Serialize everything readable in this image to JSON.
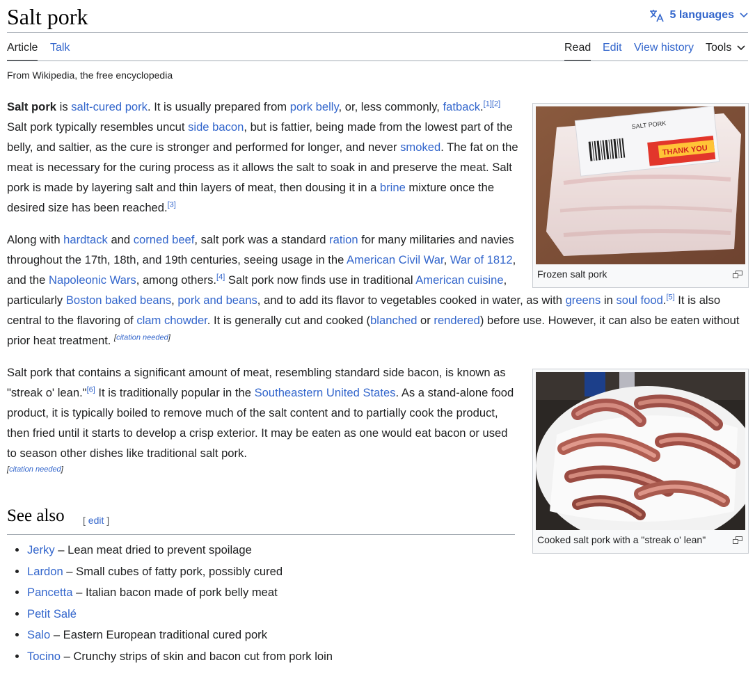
{
  "header": {
    "title": "Salt pork",
    "languages_label": "5 languages"
  },
  "tabs": {
    "article": "Article",
    "talk": "Talk",
    "read": "Read",
    "edit": "Edit",
    "history": "View history",
    "tools": "Tools"
  },
  "tagline": "From Wikipedia, the free encyclopedia",
  "p1": {
    "t0": "Salt pork",
    "t1": " is ",
    "l1": "salt-cured pork",
    "t2": ". It is usually prepared from ",
    "l2": "pork belly",
    "t3": ", or, less commonly, ",
    "l3": "fatback",
    "t4": ".",
    "r1": "[1]",
    "r2": "[2]",
    "t5": " Salt pork typically resembles uncut ",
    "l4": "side bacon",
    "t6": ", but is fattier, being made from the lowest part of the belly, and saltier, as the cure is stronger and performed for longer, and never ",
    "l5": "smoked",
    "t7": ". The fat on the meat is necessary for the curing process as it allows the salt to soak in and preserve the meat. Salt pork is made by layering salt and thin layers of meat, then dousing it in a ",
    "l6": "brine",
    "t8": " mixture once the desired size has been reached.",
    "r3": "[3]"
  },
  "p2": {
    "t0": "Along with ",
    "l1": "hardtack",
    "t1": " and ",
    "l2": "corned beef",
    "t2": ", salt pork was a standard ",
    "l3": "ration",
    "t3": " for many militaries and navies throughout the 17th, 18th, and 19th centuries, seeing usage in the ",
    "l4": "American Civil War",
    "t4": ", ",
    "l5": "War of 1812",
    "t5": ", and the ",
    "l6": "Napoleonic Wars",
    "t6": ", among others.",
    "r4": "[4]",
    "t7": " Salt pork now finds use in traditional ",
    "l7": "American cuisine",
    "t8": ", particularly ",
    "l8": "Boston baked beans",
    "t9": ", ",
    "l9": "pork and beans",
    "t10": ", and to add its flavor to vegetables cooked in water, as with ",
    "l10": "greens",
    "t11": " in ",
    "l11": "soul food",
    "t12": ".",
    "r5": "[5]",
    "t13": " It is also central to the flavoring of ",
    "l12": "clam chowder",
    "t14": ". It is generally cut and cooked (",
    "l13": "blanched",
    "t15": " or ",
    "l14": "rendered",
    "t16": ") before use. However, it can also be eaten without prior heat treatment. ",
    "cn_open": "[",
    "cn_text": "citation needed",
    "cn_close": "]"
  },
  "p3": {
    "t0": "Salt pork that contains a significant amount of meat, resembling standard side bacon, is known as \"streak o' lean.\"",
    "r6": "[6]",
    "t1": " It is traditionally popular in the ",
    "l1": "Southeastern United States",
    "t2": ". As a stand-alone food product, it is typically boiled to remove much of the salt content and to partially cook the product, then fried until it starts to develop a crisp exterior. It may be eaten as one would eat bacon or used to season other dishes like traditional salt pork.",
    "cn_open": "[",
    "cn_text": "citation needed",
    "cn_close": "]"
  },
  "figures": {
    "frozen_caption": "Frozen salt pork",
    "cooked_caption": "Cooked salt pork with a \"streak o' lean\"",
    "label_text": "SALT PORK",
    "label_thanks": "THANK YOU"
  },
  "see_also": {
    "heading": "See also",
    "edit_open": "[ ",
    "edit_label": "edit",
    "edit_close": " ]",
    "items": [
      {
        "link": "Jerky",
        "desc": " – Lean meat dried to prevent spoilage"
      },
      {
        "link": "Lardon",
        "desc": " – Small cubes of fatty pork, possibly cured"
      },
      {
        "link": "Pancetta",
        "desc": " – Italian bacon made of pork belly meat"
      },
      {
        "link": "Petit Salé",
        "desc": ""
      },
      {
        "link": "Salo",
        "desc": " – Eastern European traditional cured pork"
      },
      {
        "link": "Tocino",
        "desc": " – Crunchy strips of skin and bacon cut from pork loin"
      }
    ]
  },
  "colors": {
    "link": "#3366cc",
    "text": "#202122",
    "border": "#a2a9b1"
  },
  "icons": {
    "language": "translate-icon",
    "chevron": "chevron-down-icon",
    "enlarge": "enlarge-icon"
  }
}
